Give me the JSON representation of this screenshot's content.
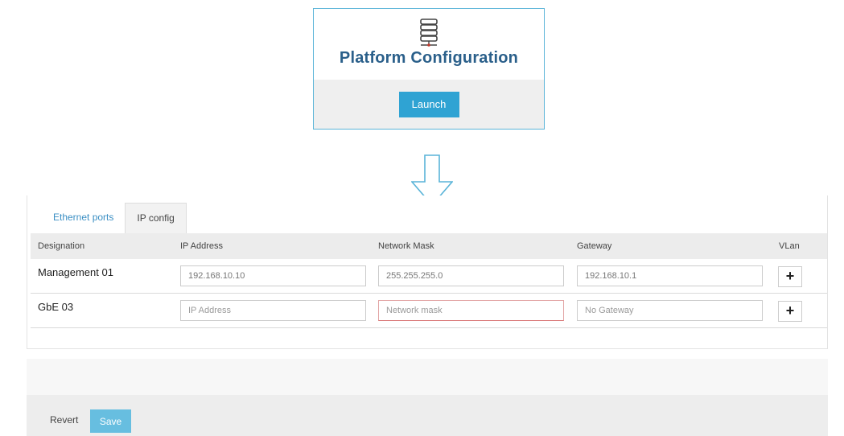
{
  "card": {
    "icon": "server-icon",
    "title": "Platform Configuration",
    "launch_label": "Launch"
  },
  "arrow": {
    "icon": "down-arrow-icon"
  },
  "tabs": [
    {
      "label": "Ethernet ports",
      "active": false
    },
    {
      "label": "IP config",
      "active": true
    }
  ],
  "table": {
    "headers": [
      "Designation",
      "IP Address",
      "Network Mask",
      "Gateway",
      "VLan"
    ],
    "rows": [
      {
        "designation": "Management 01",
        "ip": {
          "value": "192.168.10.10",
          "placeholder": ""
        },
        "mask": {
          "value": "255.255.255.0",
          "placeholder": ""
        },
        "gateway": {
          "value": "192.168.10.1",
          "placeholder": ""
        },
        "vlan_button": "+"
      },
      {
        "designation": "GbE 03",
        "ip": {
          "value": "",
          "placeholder": "IP Address"
        },
        "mask": {
          "value": "",
          "placeholder": "Network mask",
          "invalid": true
        },
        "gateway": {
          "value": "",
          "placeholder": "No Gateway"
        },
        "vlan_button": "+"
      }
    ]
  },
  "footer": {
    "revert_label": "Revert",
    "save_label": "Save"
  },
  "colors": {
    "accent": "#2fa3d3",
    "title": "#2a5f8a",
    "card_border": "#5ab4d8",
    "save_button": "#67bee0",
    "invalid_border": "#d97676"
  }
}
